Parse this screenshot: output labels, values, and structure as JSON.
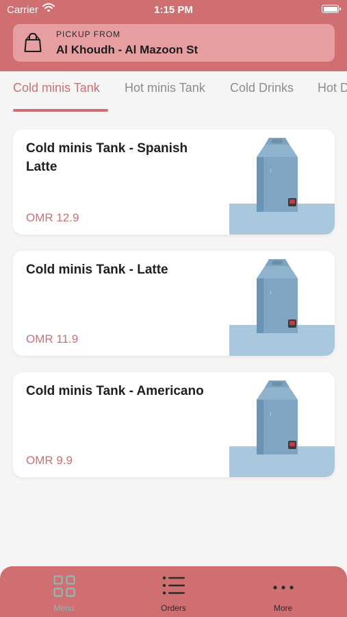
{
  "status_bar": {
    "carrier": "Carrier",
    "time": "1:15 PM"
  },
  "pickup": {
    "label": "PICKUP FROM",
    "location": "Al Khoudh - Al Mazoon St",
    "icon": "shopping-bag-icon"
  },
  "tabs": [
    {
      "label": "Cold minis Tank",
      "active": true
    },
    {
      "label": "Hot minis Tank",
      "active": false
    },
    {
      "label": "Cold Drinks",
      "active": false
    },
    {
      "label": "Hot D",
      "active": false
    }
  ],
  "products": [
    {
      "title": "Cold minis Tank - Spanish Latte",
      "price": "OMR 12.9"
    },
    {
      "title": "Cold minis Tank - Latte",
      "price": "OMR 11.9"
    },
    {
      "title": "Cold minis Tank - Americano",
      "price": "OMR 9.9"
    }
  ],
  "bottom_nav": [
    {
      "label": "Menu",
      "icon": "grid-icon",
      "active": true
    },
    {
      "label": "Orders",
      "icon": "list-icon",
      "active": false
    },
    {
      "label": "More",
      "icon": "more-dots-icon",
      "active": false
    }
  ],
  "colors": {
    "accent": "#cf6f72",
    "pickup_bg": "#e79ea1",
    "background": "#f6f5f5",
    "nav_active": "#8fb6b8"
  }
}
